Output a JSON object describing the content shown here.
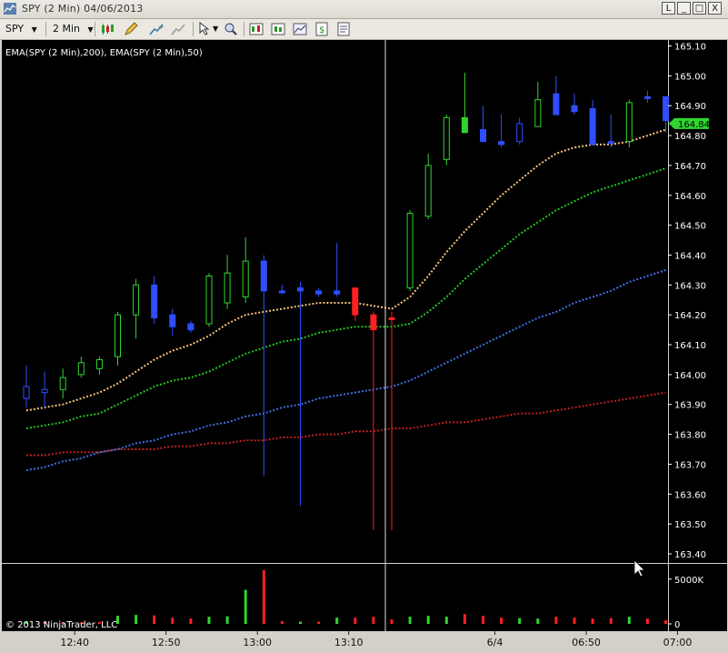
{
  "window": {
    "title": "SPY (2 Min)  04/06/2013",
    "buttons": [
      "L",
      "_",
      "□",
      "X"
    ]
  },
  "toolbar": {
    "instrument": "SPY",
    "interval": "2 Min",
    "icons": [
      "bar-type-icon",
      "pencil-draw-icon",
      "add-indicator-icon",
      "strategy-icon",
      "zoom-cursor-icon",
      "zoom-in-icon",
      "data-box-icon",
      "chart-trader-icon",
      "dollar-icon",
      "properties-icon"
    ]
  },
  "colors": {
    "background": "#000000",
    "up_candle": "#2fd62f",
    "down_candle": "#2f4fff",
    "red_candle": "#ff2020",
    "ema_orange": "#f5c17a",
    "ema_green": "#22c422",
    "ema_blue": "#3f6fe6",
    "ema_red": "#c02020",
    "price_badge": "#2fd62f",
    "axis_text": "#ffffff"
  },
  "chart_data": {
    "type": "candlestick",
    "indicator_label": "EMA(SPY (2 Min),200), EMA(SPY (2 Min),50)",
    "y_ticks": [
      165.1,
      165.0,
      164.9,
      164.8,
      164.7,
      164.6,
      164.5,
      164.4,
      164.3,
      164.2,
      164.1,
      164.0,
      163.9,
      163.8,
      163.7,
      163.6,
      163.5,
      163.4
    ],
    "ylim": [
      163.37,
      165.12
    ],
    "current_price": "164.84",
    "x_ticks": [
      "12:40",
      "12:50",
      "13:00",
      "13:10",
      "6/4",
      "06:50",
      "07:00"
    ],
    "x_tick_bars": [
      2,
      7,
      12,
      17,
      25,
      30,
      35
    ],
    "crosshair_bar": 20,
    "candles": [
      {
        "o": 163.92,
        "h": 164.03,
        "l": 163.89,
        "c": 163.96,
        "color": "blue"
      },
      {
        "o": 163.94,
        "h": 164.01,
        "l": 163.89,
        "c": 163.95,
        "color": "blue"
      },
      {
        "o": 163.95,
        "h": 164.02,
        "l": 163.92,
        "c": 163.99,
        "color": "green"
      },
      {
        "o": 164.0,
        "h": 164.06,
        "l": 163.99,
        "c": 164.04,
        "color": "green"
      },
      {
        "o": 164.02,
        "h": 164.06,
        "l": 164.0,
        "c": 164.05,
        "color": "green"
      },
      {
        "o": 164.06,
        "h": 164.21,
        "l": 164.03,
        "c": 164.2,
        "color": "green"
      },
      {
        "o": 164.2,
        "h": 164.32,
        "l": 164.12,
        "c": 164.3,
        "color": "green"
      },
      {
        "o": 164.3,
        "h": 164.33,
        "l": 164.17,
        "c": 164.19,
        "color": "blue"
      },
      {
        "o": 164.2,
        "h": 164.22,
        "l": 164.13,
        "c": 164.16,
        "color": "blue"
      },
      {
        "o": 164.17,
        "h": 164.18,
        "l": 164.14,
        "c": 164.15,
        "color": "blue"
      },
      {
        "o": 164.17,
        "h": 164.34,
        "l": 164.16,
        "c": 164.33,
        "color": "green"
      },
      {
        "o": 164.24,
        "h": 164.4,
        "l": 164.22,
        "c": 164.34,
        "color": "green"
      },
      {
        "o": 164.26,
        "h": 164.46,
        "l": 164.24,
        "c": 164.38,
        "color": "green"
      },
      {
        "o": 164.38,
        "h": 164.4,
        "l": 163.66,
        "c": 164.28,
        "color": "blue"
      },
      {
        "o": 164.28,
        "h": 164.3,
        "l": 164.27,
        "c": 164.28,
        "color": "blue"
      },
      {
        "o": 164.29,
        "h": 164.31,
        "l": 163.56,
        "c": 164.28,
        "color": "blue"
      },
      {
        "o": 164.28,
        "h": 164.29,
        "l": 164.26,
        "c": 164.27,
        "color": "blue"
      },
      {
        "o": 164.28,
        "h": 164.44,
        "l": 164.26,
        "c": 164.27,
        "color": "blue"
      },
      {
        "o": 164.29,
        "h": 164.29,
        "l": 164.18,
        "c": 164.2,
        "color": "red"
      },
      {
        "o": 164.2,
        "h": 164.21,
        "l": 163.48,
        "c": 164.15,
        "color": "red"
      },
      {
        "o": 164.19,
        "h": 164.21,
        "l": 163.48,
        "c": 164.19,
        "color": "red"
      },
      {
        "o": 164.29,
        "h": 164.55,
        "l": 164.28,
        "c": 164.54,
        "color": "green"
      },
      {
        "o": 164.53,
        "h": 164.74,
        "l": 164.52,
        "c": 164.7,
        "color": "green"
      },
      {
        "o": 164.72,
        "h": 164.87,
        "l": 164.7,
        "c": 164.86,
        "color": "green"
      },
      {
        "o": 164.86,
        "h": 165.01,
        "l": 164.82,
        "c": 164.81,
        "color": "green"
      },
      {
        "o": 164.82,
        "h": 164.9,
        "l": 164.78,
        "c": 164.78,
        "color": "blue"
      },
      {
        "o": 164.78,
        "h": 164.87,
        "l": 164.76,
        "c": 164.77,
        "color": "blue"
      },
      {
        "o": 164.78,
        "h": 164.86,
        "l": 164.77,
        "c": 164.84,
        "color": "blue"
      },
      {
        "o": 164.83,
        "h": 164.98,
        "l": 164.83,
        "c": 164.92,
        "color": "green"
      },
      {
        "o": 164.94,
        "h": 165.0,
        "l": 164.87,
        "c": 164.87,
        "color": "blue"
      },
      {
        "o": 164.9,
        "h": 164.94,
        "l": 164.87,
        "c": 164.88,
        "color": "blue"
      },
      {
        "o": 164.89,
        "h": 164.92,
        "l": 164.78,
        "c": 164.77,
        "color": "blue"
      },
      {
        "o": 164.78,
        "h": 164.87,
        "l": 164.76,
        "c": 164.78,
        "color": "blue"
      },
      {
        "o": 164.78,
        "h": 164.92,
        "l": 164.76,
        "c": 164.91,
        "color": "green"
      },
      {
        "o": 164.93,
        "h": 164.95,
        "l": 164.91,
        "c": 164.93,
        "color": "blue"
      },
      {
        "o": 164.93,
        "h": 164.93,
        "l": 164.81,
        "c": 164.85,
        "color": "blue"
      }
    ],
    "ema_fast_orange": [
      163.88,
      163.89,
      163.9,
      163.92,
      163.94,
      163.97,
      164.01,
      164.05,
      164.08,
      164.1,
      164.13,
      164.17,
      164.2,
      164.21,
      164.22,
      164.23,
      164.24,
      164.24,
      164.24,
      164.23,
      164.22,
      164.26,
      164.33,
      164.41,
      164.48,
      164.54,
      164.6,
      164.65,
      164.7,
      164.74,
      164.76,
      164.77,
      164.77,
      164.78,
      164.8,
      164.82
    ],
    "ema_mid_green": [
      163.82,
      163.83,
      163.84,
      163.86,
      163.87,
      163.9,
      163.93,
      163.96,
      163.98,
      163.99,
      164.01,
      164.04,
      164.07,
      164.09,
      164.11,
      164.12,
      164.14,
      164.15,
      164.16,
      164.16,
      164.16,
      164.17,
      164.21,
      164.26,
      164.32,
      164.37,
      164.42,
      164.47,
      164.51,
      164.55,
      164.58,
      164.61,
      164.63,
      164.65,
      164.67,
      164.69
    ],
    "ema_slow_blue": [
      163.68,
      163.69,
      163.71,
      163.72,
      163.74,
      163.75,
      163.77,
      163.78,
      163.8,
      163.81,
      163.83,
      163.84,
      163.86,
      163.87,
      163.89,
      163.9,
      163.92,
      163.93,
      163.94,
      163.95,
      163.96,
      163.98,
      164.01,
      164.04,
      164.07,
      164.1,
      164.13,
      164.16,
      164.19,
      164.21,
      164.24,
      164.26,
      164.28,
      164.31,
      164.33,
      164.35
    ],
    "ema_200_red": [
      163.73,
      163.73,
      163.74,
      163.74,
      163.74,
      163.75,
      163.75,
      163.75,
      163.76,
      163.76,
      163.77,
      163.77,
      163.78,
      163.78,
      163.79,
      163.79,
      163.8,
      163.8,
      163.81,
      163.81,
      163.82,
      163.82,
      163.83,
      163.84,
      163.84,
      163.85,
      163.86,
      163.87,
      163.87,
      163.88,
      163.89,
      163.9,
      163.91,
      163.92,
      163.93,
      163.94
    ],
    "volume_label": "5000K",
    "volume_zero_label": "0",
    "volume_max": 6500,
    "volume": [
      {
        "v": 300,
        "color": "green"
      },
      {
        "v": 280,
        "color": "red"
      },
      {
        "v": 200,
        "color": "red"
      },
      {
        "v": 180,
        "color": "red"
      },
      {
        "v": 220,
        "color": "red"
      },
      {
        "v": 900,
        "color": "green"
      },
      {
        "v": 1000,
        "color": "green"
      },
      {
        "v": 950,
        "color": "red"
      },
      {
        "v": 700,
        "color": "red"
      },
      {
        "v": 600,
        "color": "red"
      },
      {
        "v": 800,
        "color": "green"
      },
      {
        "v": 850,
        "color": "green"
      },
      {
        "v": 3800,
        "color": "green"
      },
      {
        "v": 6000,
        "color": "red"
      },
      {
        "v": 300,
        "color": "red"
      },
      {
        "v": 250,
        "color": "green"
      },
      {
        "v": 240,
        "color": "red"
      },
      {
        "v": 700,
        "color": "green"
      },
      {
        "v": 700,
        "color": "red"
      },
      {
        "v": 800,
        "color": "red"
      },
      {
        "v": 500,
        "color": "red"
      },
      {
        "v": 800,
        "color": "green"
      },
      {
        "v": 900,
        "color": "green"
      },
      {
        "v": 800,
        "color": "green"
      },
      {
        "v": 1100,
        "color": "red"
      },
      {
        "v": 900,
        "color": "red"
      },
      {
        "v": 700,
        "color": "red"
      },
      {
        "v": 650,
        "color": "green"
      },
      {
        "v": 600,
        "color": "green"
      },
      {
        "v": 800,
        "color": "red"
      },
      {
        "v": 700,
        "color": "red"
      },
      {
        "v": 600,
        "color": "red"
      },
      {
        "v": 650,
        "color": "red"
      },
      {
        "v": 800,
        "color": "green"
      },
      {
        "v": 600,
        "color": "red"
      },
      {
        "v": 400,
        "color": "red"
      }
    ],
    "copyright": "© 2013 NinjaTrader, LLC"
  }
}
